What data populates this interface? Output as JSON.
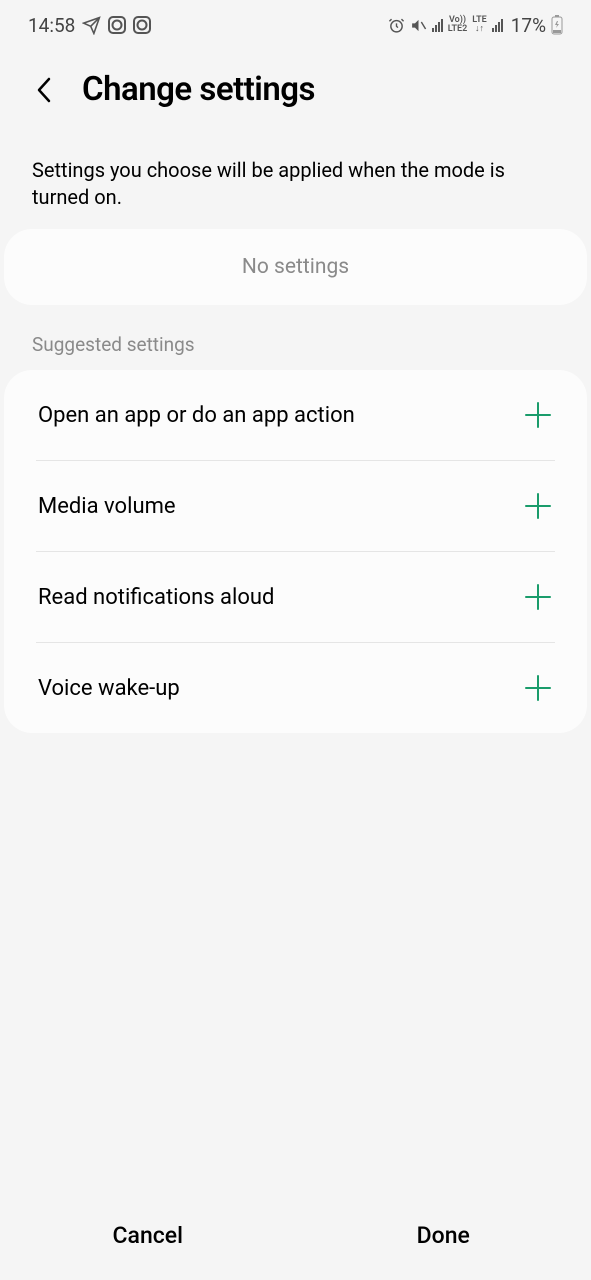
{
  "statusBar": {
    "time": "14:58",
    "batteryPercent": "17%"
  },
  "header": {
    "title": "Change settings"
  },
  "description": "Settings you choose will be applied when the mode is turned on.",
  "noSettingsLabel": "No settings",
  "sectionLabel": "Suggested settings",
  "suggestedSettings": [
    {
      "label": "Open an app or do an app action"
    },
    {
      "label": "Media volume"
    },
    {
      "label": "Read notifications aloud"
    },
    {
      "label": "Voice wake-up"
    }
  ],
  "bottomBar": {
    "cancel": "Cancel",
    "done": "Done"
  }
}
